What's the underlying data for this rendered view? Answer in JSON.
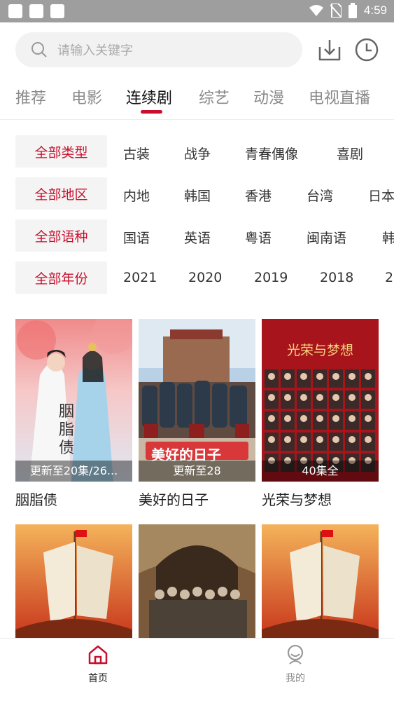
{
  "status_bar": {
    "time": "4:59"
  },
  "search": {
    "placeholder": "请输入关键字"
  },
  "tabs": [
    {
      "label": "推荐"
    },
    {
      "label": "电影"
    },
    {
      "label": "连续剧"
    },
    {
      "label": "综艺"
    },
    {
      "label": "动漫"
    },
    {
      "label": "电视直播"
    }
  ],
  "active_tab": "连续剧",
  "filters": [
    {
      "selected": "全部类型",
      "options": [
        "古装",
        "战争",
        "青春偶像",
        "喜剧"
      ]
    },
    {
      "selected": "全部地区",
      "options": [
        "内地",
        "韩国",
        "香港",
        "台湾",
        "日本"
      ]
    },
    {
      "selected": "全部语种",
      "options": [
        "国语",
        "英语",
        "粤语",
        "闽南语",
        "韩"
      ]
    },
    {
      "selected": "全部年份",
      "options": [
        "2021",
        "2020",
        "2019",
        "2018",
        "2"
      ]
    }
  ],
  "cards": [
    {
      "title": "胭脂债",
      "badge": "更新至20集/26...",
      "poster_text": "胭脂债"
    },
    {
      "title": "美好的日子",
      "badge": "更新至28",
      "poster_text": "美好的日子"
    },
    {
      "title": "光荣与梦想",
      "badge": "40集全",
      "poster_text": "光荣与梦想"
    }
  ],
  "bottom_nav": [
    {
      "label": "首页",
      "icon": "home-icon",
      "active": true
    },
    {
      "label": "我的",
      "icon": "profile-icon",
      "active": false
    }
  ],
  "colors": {
    "accent": "#c8102e",
    "status_bar": "#9e9e9e"
  }
}
